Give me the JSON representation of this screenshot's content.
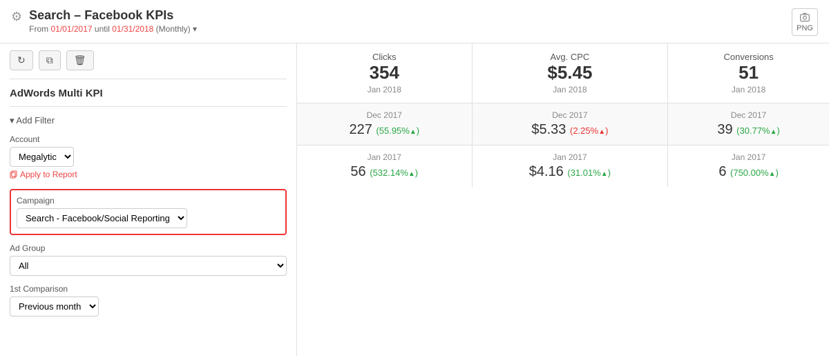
{
  "header": {
    "title": "Search – Facebook KPIs",
    "subtitle_prefix": "From ",
    "date_start": "01/01/2017",
    "date_end": "01/31/2018",
    "date_period": "(Monthly)",
    "gear_icon": "⚙",
    "png_label": "PNG"
  },
  "sidebar": {
    "toolbar": {
      "refresh_icon": "↻",
      "copy_icon": "⧉",
      "delete_icon": "🗑"
    },
    "widget_title": "AdWords Multi KPI",
    "add_filter_label": "Add Filter",
    "account": {
      "label": "Account",
      "value": "Megalytic",
      "apply_label": "Apply to Report"
    },
    "campaign": {
      "label": "Campaign",
      "value": "Search - Facebook/Social Reporting"
    },
    "ad_group": {
      "label": "Ad Group",
      "value": "All"
    },
    "comparison_1": {
      "label": "1st Comparison",
      "value": "Previous month"
    }
  },
  "table": {
    "columns": [
      {
        "key": "clicks",
        "label": "Clicks"
      },
      {
        "key": "avg_cpc",
        "label": "Avg. CPC"
      },
      {
        "key": "conversions",
        "label": "Conversions"
      }
    ],
    "rows": [
      {
        "type": "current",
        "date": "Jan 2018",
        "clicks_value": "354",
        "avg_cpc_value": "$5.45",
        "conversions_value": "51"
      },
      {
        "type": "comparison1",
        "date": "Dec 2017",
        "clicks_value": "227",
        "clicks_change": "55.95%",
        "clicks_direction": "up",
        "avg_cpc_value": "$5.33",
        "avg_cpc_change": "2.25%",
        "avg_cpc_direction": "up",
        "conversions_value": "39",
        "conversions_change": "30.77%",
        "conversions_direction": "up"
      },
      {
        "type": "comparison2",
        "date": "Jan 2017",
        "clicks_value": "56",
        "clicks_change": "532.14%",
        "clicks_direction": "up",
        "avg_cpc_value": "$4.16",
        "avg_cpc_change": "31.01%",
        "avg_cpc_direction": "up",
        "conversions_value": "6",
        "conversions_change": "750.00%",
        "conversions_direction": "up"
      }
    ]
  }
}
